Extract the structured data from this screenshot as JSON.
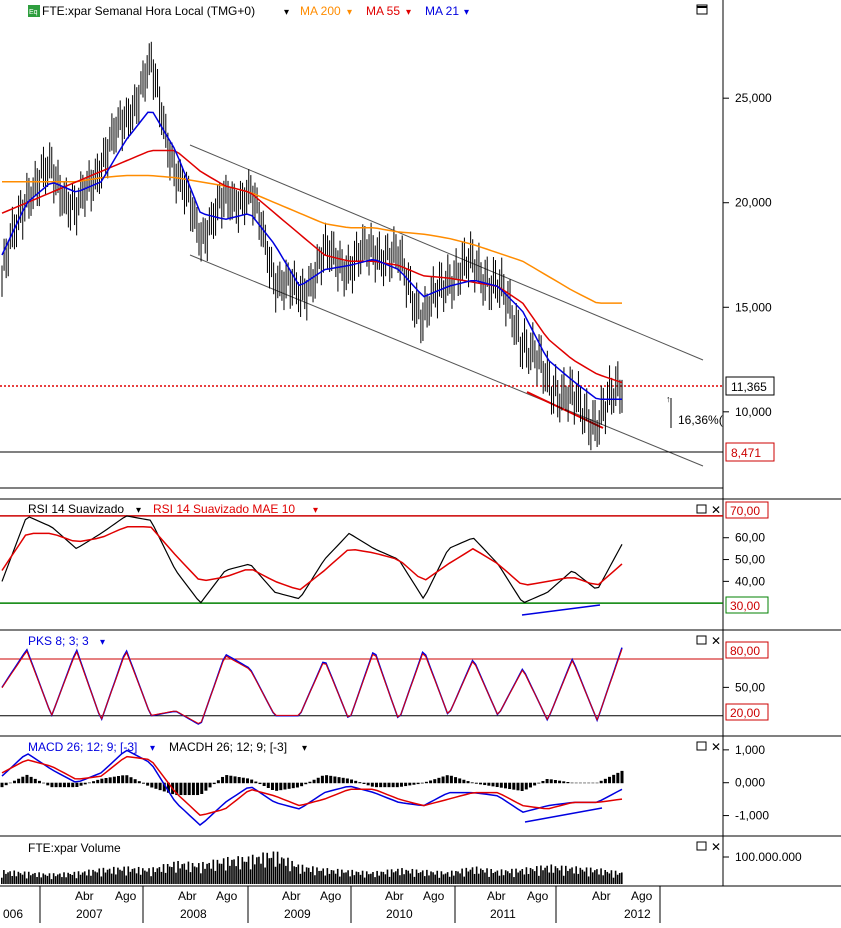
{
  "panels": {
    "price": {
      "symbol_badge": "Eq",
      "title": "FTE:xpar Semanal Hora Local (TMG+0)",
      "ma200_label": "MA 200",
      "ma55_label": "MA 55",
      "ma21_label": "MA 21",
      "last_price_label": "11,365",
      "support_label": "8,471",
      "gain_annotation": "16,36%(",
      "y_ticks": [
        "25,000",
        "20,000",
        "15,000",
        "10,000"
      ]
    },
    "rsi": {
      "label_main": "RSI 14 Suavizado",
      "label_signal": "RSI 14 Suavizado MAE 10",
      "level_high": "70,00",
      "level_low": "30,00",
      "y_ticks": [
        "60,00",
        "50,00",
        "40,00"
      ]
    },
    "stoch": {
      "label": "PKS 8; 3; 3",
      "level_high": "80,00",
      "level_low": "20,00",
      "y_ticks": [
        "50,00"
      ]
    },
    "macd": {
      "label_main": "MACD 26; 12; 9; [-3]",
      "label_hist": "MACDH 26; 12; 9; [-3]",
      "y_ticks": [
        "1,000",
        "0,000",
        "-1,000"
      ]
    },
    "volume": {
      "label": "FTE:xpar Volume",
      "y_ticks": [
        "100.000.000"
      ]
    }
  },
  "x_axis": {
    "months": [
      "Abr",
      "Ago",
      "Abr",
      "Ago",
      "Abr",
      "Ago",
      "Abr",
      "Ago",
      "Abr",
      "Ago",
      "Abr",
      "Ago"
    ],
    "years": [
      "006",
      "2007",
      "2008",
      "2009",
      "2010",
      "2011",
      "2012"
    ]
  },
  "colors": {
    "ma200": "#ff8c00",
    "ma55": "#e00000",
    "ma21": "#0000e0",
    "price": "#000000",
    "rsi_level_high": "#cc0000",
    "rsi_level_low": "#008000"
  },
  "chart_data": [
    {
      "type": "line",
      "name": "price",
      "x": [
        "2006-03",
        "2006-06",
        "2006-09",
        "2006-12",
        "2007-03",
        "2007-06",
        "2007-09",
        "2007-12",
        "2008-03",
        "2008-06",
        "2008-09",
        "2008-12",
        "2009-03",
        "2009-06",
        "2009-09",
        "2009-12",
        "2010-03",
        "2010-06",
        "2010-09",
        "2010-12",
        "2011-03",
        "2011-06",
        "2011-09",
        "2011-12",
        "2012-03",
        "2012-06"
      ],
      "series": [
        {
          "name": "FTE:xpar",
          "values": [
            16.5,
            20.5,
            21.5,
            19.5,
            22.0,
            24.0,
            26.5,
            21.5,
            18.5,
            20.0,
            20.5,
            16.5,
            15.5,
            17.5,
            17.0,
            17.8,
            17.2,
            14.5,
            16.5,
            17.0,
            16.0,
            13.5,
            11.5,
            10.5,
            9.5,
            11.365
          ]
        },
        {
          "name": "MA 200",
          "values": [
            21.0,
            21.0,
            21.0,
            21.0,
            21.2,
            21.3,
            21.3,
            21.2,
            21.0,
            20.8,
            20.5,
            20.0,
            19.5,
            19.0,
            18.8,
            18.8,
            18.6,
            18.5,
            18.3,
            18.0,
            17.6,
            17.2,
            16.5,
            15.8,
            15.2,
            15.2
          ]
        },
        {
          "name": "MA 55",
          "values": [
            19.5,
            20.0,
            20.5,
            21.0,
            21.5,
            22.0,
            22.5,
            22.5,
            21.5,
            20.8,
            20.5,
            19.5,
            18.5,
            17.5,
            17.2,
            17.2,
            17.0,
            16.5,
            16.4,
            16.2,
            16.0,
            15.2,
            13.5,
            12.5,
            11.8,
            11.4
          ]
        },
        {
          "name": "MA 21",
          "values": [
            17.5,
            20.0,
            21.0,
            20.5,
            21.0,
            23.0,
            24.5,
            22.5,
            19.5,
            19.2,
            19.5,
            18.0,
            16.0,
            16.8,
            17.0,
            17.3,
            16.8,
            15.5,
            16.0,
            16.3,
            16.0,
            14.8,
            12.5,
            11.5,
            10.6,
            10.6
          ]
        }
      ],
      "ylim": [
        6.5,
        28.5
      ],
      "horizontal_lines": [
        11.365,
        8.471
      ]
    },
    {
      "type": "line",
      "name": "rsi",
      "series": [
        {
          "name": "RSI 14 Suavizado",
          "values": [
            40,
            70,
            65,
            55,
            62,
            70,
            68,
            45,
            30,
            45,
            48,
            35,
            32,
            50,
            62,
            55,
            50,
            32,
            55,
            60,
            48,
            30,
            35,
            45,
            36,
            57
          ]
        },
        {
          "name": "RSI 14 Suavizado MAE 10",
          "values": [
            45,
            62,
            62,
            58,
            60,
            65,
            65,
            52,
            40,
            42,
            46,
            40,
            36,
            45,
            55,
            53,
            50,
            40,
            48,
            55,
            48,
            38,
            40,
            42,
            38,
            48
          ]
        }
      ],
      "levels": [
        70,
        30
      ],
      "ylim": [
        20,
        75
      ]
    },
    {
      "type": "line",
      "name": "stochastic",
      "series": [
        {
          "name": "PKS 8; 3; 3",
          "values": [
            50,
            90,
            20,
            90,
            15,
            90,
            20,
            25,
            10,
            85,
            70,
            20,
            20,
            80,
            15,
            90,
            15,
            90,
            20,
            80,
            20,
            70,
            15,
            80,
            15,
            92
          ]
        }
      ],
      "levels": [
        80,
        20
      ],
      "ylim": [
        5,
        100
      ]
    },
    {
      "type": "line",
      "name": "macd",
      "series": [
        {
          "name": "MACD 26; 12; 9; [-3]",
          "values": [
            0.2,
            0.9,
            0.4,
            0.0,
            0.3,
            1.0,
            0.6,
            -0.6,
            -1.3,
            -0.6,
            -0.1,
            -0.6,
            -0.8,
            -0.3,
            -0.1,
            -0.3,
            -0.6,
            -0.7,
            -0.3,
            -0.3,
            -0.4,
            -0.9,
            -0.7,
            -0.6,
            -0.6,
            -0.2
          ]
        },
        {
          "name": "MACDH 26; 12; 9; [-3]",
          "values": [
            0.3,
            0.7,
            0.5,
            0.1,
            0.2,
            0.8,
            0.7,
            -0.3,
            -1.0,
            -0.8,
            -0.2,
            -0.4,
            -0.7,
            -0.5,
            -0.2,
            -0.2,
            -0.5,
            -0.7,
            -0.5,
            -0.3,
            -0.3,
            -0.7,
            -0.8,
            -0.6,
            -0.6,
            -0.5
          ]
        }
      ],
      "ylim": [
        -1.5,
        1.3
      ]
    },
    {
      "type": "bar",
      "name": "volume",
      "series": [
        {
          "name": "FTE:xpar Volume",
          "values": [
            40,
            35,
            30,
            35,
            45,
            50,
            45,
            65,
            60,
            75,
            80,
            95,
            55,
            45,
            40,
            35,
            45,
            40,
            35,
            50,
            40,
            45,
            55,
            50,
            45,
            35
          ]
        }
      ]
    }
  ]
}
